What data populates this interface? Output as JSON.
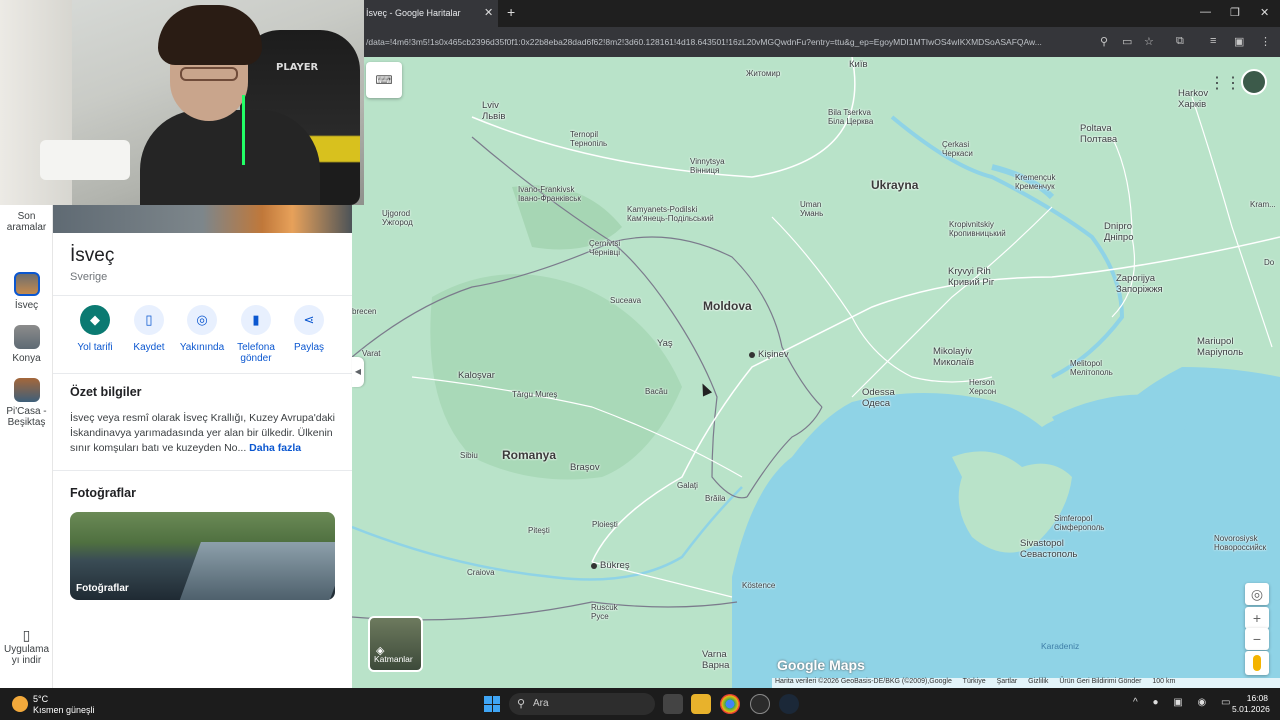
{
  "browser": {
    "tab_title": "İsveç - Google Haritalar",
    "url": "/data=!4m6!3m5!1s0x465cb2396d35f0f1:0x22b8eba28dad6f62!8m2!3d60.128161!4d18.643501!16zL20vMGQwdnFu?entry=ttu&g_ep=EgoyMDI1MTIwOS4wIKXMDSoASAFQAw..."
  },
  "rail": {
    "recent_label": "Son aramalar",
    "items": [
      {
        "label": "İsveç"
      },
      {
        "label": "Konya"
      },
      {
        "label": "Pi'Casa - Beşiktaş"
      }
    ],
    "app_label": "Uygulama yı indir"
  },
  "place": {
    "title": "İsveç",
    "subtitle": "Sverige",
    "actions": [
      {
        "label": "Yol tarifi",
        "icon": "directions-icon"
      },
      {
        "label": "Kaydet",
        "icon": "bookmark-icon"
      },
      {
        "label": "Yakınında",
        "icon": "nearby-icon"
      },
      {
        "label": "Telefona gönder",
        "icon": "phone-icon"
      },
      {
        "label": "Paylaş",
        "icon": "share-icon"
      }
    ],
    "summary_heading": "Özet bilgiler",
    "summary_text": "İsveç veya resmî olarak İsveç Krallığı, Kuzey Avrupa'daki İskandinavya yarımadasında yer alan bir ülkedir. Ülkenin sınır komşuları batı ve kuzeyden No...",
    "summary_more": "Daha fazla",
    "photos_heading": "Fotoğraflar",
    "photos_label": "Fotoğraflar"
  },
  "map": {
    "labels": {
      "kyiv": "Київ",
      "zhytomyr": "Житомир",
      "lviv_lat": "Lviv",
      "lviv_cyr": "Львів",
      "ternopil_lat": "Ternopil",
      "ternopil_cyr": "Тернопіль",
      "vinnytsia_lat": "Vinnytsya",
      "vinnytsia_cyr": "Вінниця",
      "bilatserkva_lat": "Bila Tserkva",
      "bilatserkva_cyr": "Біла Церква",
      "cherkasy_lat": "Çerkasi",
      "cherkasy_cyr": "Черкаси",
      "poltava_lat": "Poltava",
      "poltava_cyr": "Полтава",
      "kharkiv_lat": "Harkov",
      "kharkiv_cyr": "Харків",
      "ivano_lat": "Ivano-Frankivsk",
      "ivano_cyr": "Івано-Франківськ",
      "kamyanets_lat": "Kamyanets-Podilski",
      "kamyanets_cyr": "Кам'янець-Подільський",
      "uman_lat": "Uman",
      "uman_cyr": "Умань",
      "ukraine": "Ukrayna",
      "kremenchuk_lat": "Kremençuk",
      "kremenchuk_cyr": "Кременчук",
      "uzhhorod_lat": "Ujgorod",
      "uzhhorod_cyr": "Ужгород",
      "chernivtsi_lat": "Çernivtsi",
      "chernivtsi_cyr": "Чернівці",
      "kropyvnytskyi_lat": "Kropivnitskiy",
      "kropyvnytskyi_cyr": "Кропивницький",
      "dnipro_lat": "Dnipro",
      "dnipro_cyr": "Дніпро",
      "kramatorsk": "Kram...",
      "suceava": "Suceava",
      "moldova": "Moldova",
      "kryvyirih_lat": "Kryvyi Rih",
      "kryvyirih_cyr": "Кривий Ріг",
      "zaporizhzhia_lat": "Zaporijya",
      "zaporizhzhia_cyr": "Запоріжжя",
      "donetsk": "Do",
      "bereci": "brecen",
      "iasi": "Yaş",
      "chisinau": "Kişinev",
      "mykolaiv_lat": "Mikolayiv",
      "mykolaiv_cyr": "Миколаїв",
      "mariupol_lat": "Mariupol",
      "mariupol_cyr": "Маріуполь",
      "melitopol_lat": "Melitopol",
      "melitopol_cyr": "Мелітополь",
      "varat": "Varat",
      "kolozsvar": "Kaloşvar",
      "targumures": "Târgu Mureş",
      "bacau": "Bacău",
      "odesa_lat": "Odessa",
      "odesa_cyr": "Одеса",
      "kherson_lat": "Herson",
      "kherson_cyr": "Херсон",
      "sibiu": "Sibiu",
      "romania": "Romanya",
      "brasov": "Braşov",
      "galati": "Galaţi",
      "braila": "Brăila",
      "simferopol_lat": "Simferopol",
      "simferopol_cyr": "Сімферополь",
      "sevastopol_lat": "Sivastopol",
      "sevastopol_cyr": "Севастополь",
      "novorossiysk_lat": "Novorosiysk",
      "novorossiysk_cyr": "Новороссийск",
      "pitesti": "Piteşti",
      "ploiesti": "Ploieşti",
      "craiova": "Craiova",
      "bucharest": "Bükreş",
      "constanta": "Köstence",
      "ruse_lat": "Ruscuk",
      "ruse_cyr": "Русе",
      "varna_lat": "Varna",
      "varna_cyr": "Варна",
      "blacksea": "Karadeniz"
    },
    "layers_label": "Katmanlar",
    "logo": "Google Maps",
    "attribution": [
      "Harita verileri ©2026 GeoBasis-DE/BKG (©2009),Google",
      "Türkiye",
      "Şartlar",
      "Gizlilik",
      "Ürün Geri Bildirimi Gönder",
      "100 km"
    ]
  },
  "taskbar": {
    "weather_temp": "5°C",
    "weather_desc": "Kısmen güneşli",
    "search_placeholder": "Ara",
    "time": "16:08",
    "date": "5.01.2026"
  },
  "colors": {
    "land": "#b9e3c9",
    "water": "#8fd3e6",
    "accent": "#0b57d0",
    "primary_action": "#0b7a72"
  }
}
